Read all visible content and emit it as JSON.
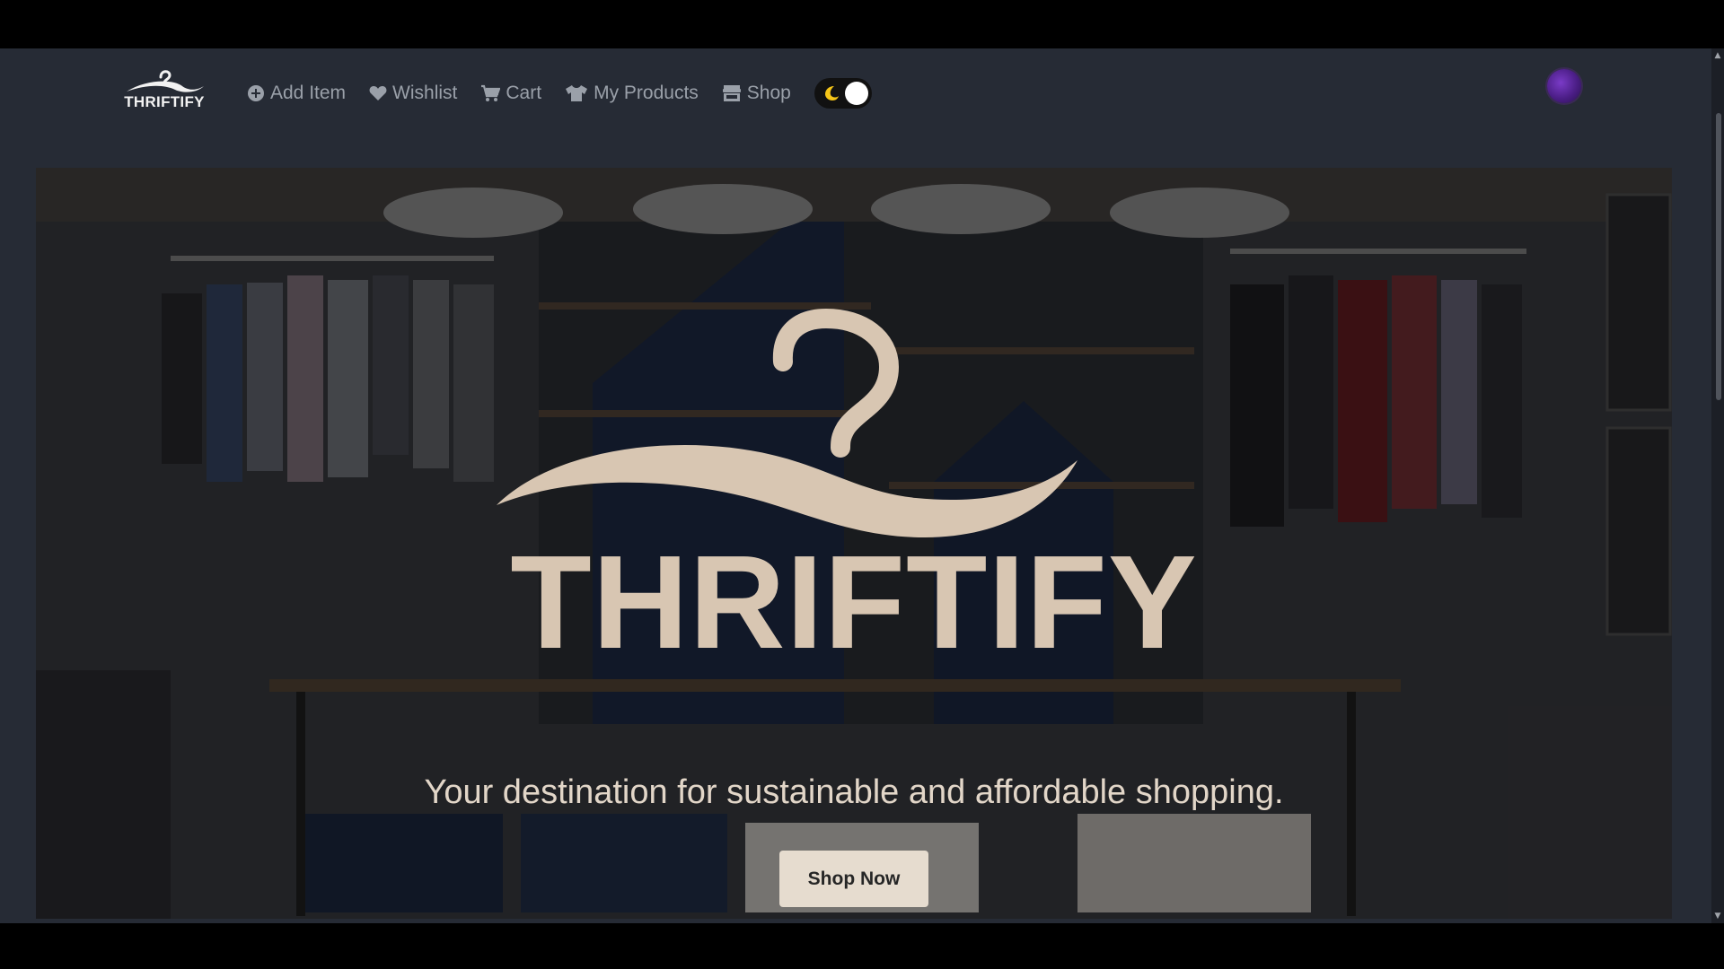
{
  "brand": {
    "name": "THRIFTIFY"
  },
  "nav": {
    "items": [
      {
        "label": "Add Item",
        "icon": "plus-circle-icon"
      },
      {
        "label": "Wishlist",
        "icon": "heart-icon"
      },
      {
        "label": "Cart",
        "icon": "cart-icon"
      },
      {
        "label": "My Products",
        "icon": "shirt-icon"
      },
      {
        "label": "Shop",
        "icon": "store-icon"
      }
    ],
    "theme_toggle": {
      "icon": "moon-icon",
      "state": "dark"
    }
  },
  "hero": {
    "logo_text": "THRIFTIFY",
    "tagline": "Your destination for sustainable and affordable shopping.",
    "cta_label": "Shop Now"
  },
  "colors": {
    "accent": "#e6dccf",
    "navbar_bg": "#262b35",
    "nav_text": "#9aa0a9"
  }
}
